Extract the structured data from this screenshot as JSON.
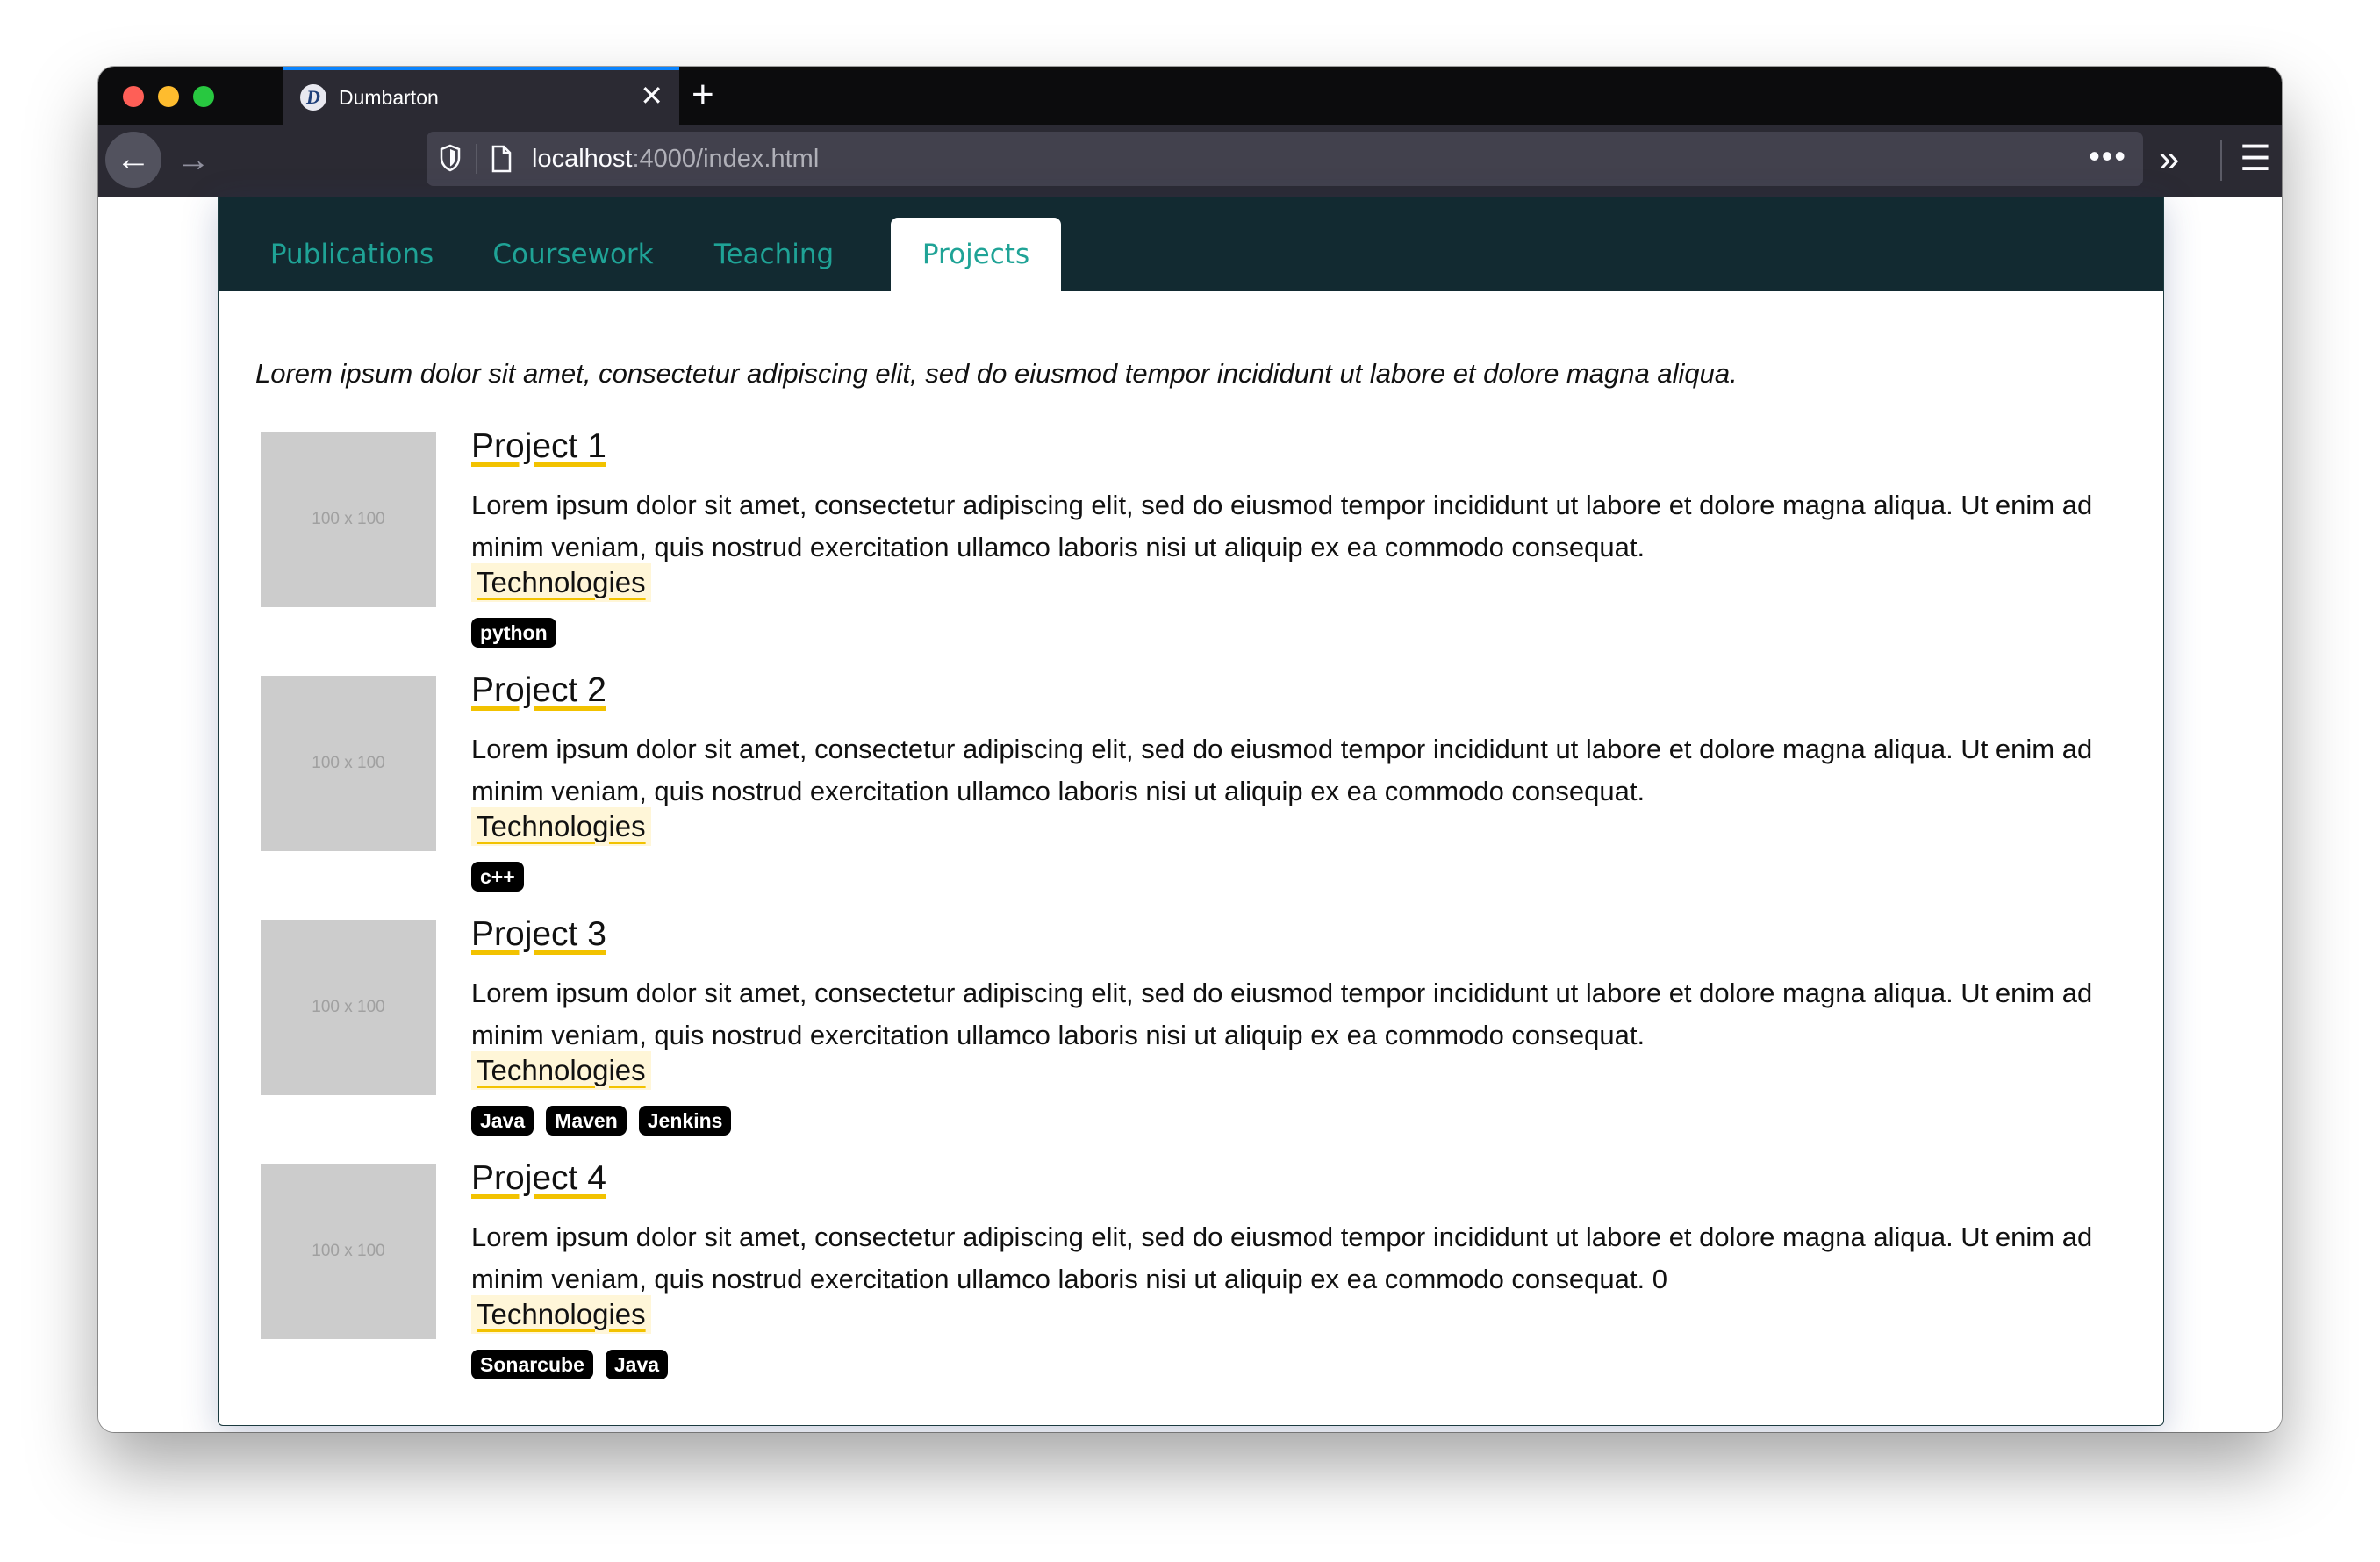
{
  "browser": {
    "tab_title": "Dumbarton",
    "favicon_letter": "D",
    "close_glyph": "✕",
    "newtab_glyph": "+",
    "url_host": "localhost",
    "url_rest": ":4000/index.html",
    "back_glyph": "←",
    "forward_glyph": "→",
    "page_actions_glyph": "•••",
    "overflow_glyph": "»",
    "menu_glyph": "☰"
  },
  "nav": {
    "tabs": [
      "Publications",
      "Coursework",
      "Teaching",
      "Projects"
    ],
    "active": "Projects"
  },
  "intro": "Lorem ipsum dolor sit amet, consectetur adipiscing elit, sed do eiusmod tempor incididunt ut labore et dolore magna aliqua.",
  "placeholder_label": "100 x 100",
  "projects": [
    {
      "title": "Project 1",
      "description": "Lorem ipsum dolor sit amet, consectetur adipiscing elit, sed do eiusmod tempor incididunt ut labore et dolore magna aliqua. Ut enim ad minim veniam, quis nostrud exercitation ullamco laboris nisi ut aliquip ex ea commodo consequat.",
      "tech_label": "Technologies",
      "tags": [
        "python"
      ]
    },
    {
      "title": "Project 2",
      "description": "Lorem ipsum dolor sit amet, consectetur adipiscing elit, sed do eiusmod tempor incididunt ut labore et dolore magna aliqua. Ut enim ad minim veniam, quis nostrud exercitation ullamco laboris nisi ut aliquip ex ea commodo consequat.",
      "tech_label": "Technologies",
      "tags": [
        "c++"
      ]
    },
    {
      "title": "Project 3",
      "description": "Lorem ipsum dolor sit amet, consectetur adipiscing elit, sed do eiusmod tempor incididunt ut labore et dolore magna aliqua. Ut enim ad minim veniam, quis nostrud exercitation ullamco laboris nisi ut aliquip ex ea commodo consequat.",
      "tech_label": "Technologies",
      "tags": [
        "Java",
        "Maven",
        "Jenkins"
      ]
    },
    {
      "title": "Project 4",
      "description": "Lorem ipsum dolor sit amet, consectetur adipiscing elit, sed do eiusmod tempor incididunt ut labore et dolore magna aliqua. Ut enim ad minim veniam, quis nostrud exercitation ullamco laboris nisi ut aliquip ex ea commodo consequat. 0",
      "tech_label": "Technologies",
      "tags": [
        "Sonarcube",
        "Java"
      ]
    }
  ],
  "colors": {
    "nav_bg": "#122a31",
    "nav_text": "#1fa396",
    "underline_accent": "#f2c200",
    "tag_bg": "#000000"
  }
}
